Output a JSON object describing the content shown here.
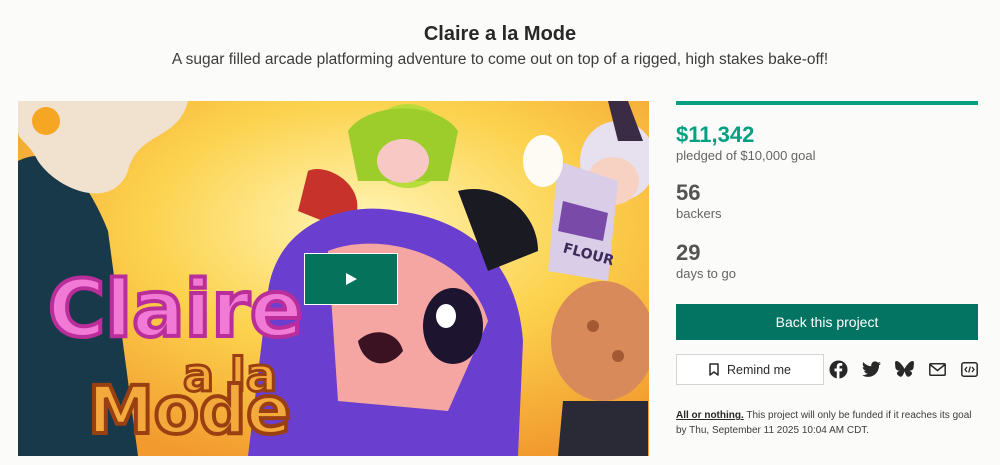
{
  "project": {
    "title": "Claire a la Mode",
    "subtitle": "A sugar filled arcade platforming adventure to come out on top of a rigged, high stakes bake-off!"
  },
  "media": {
    "logo_line1": "Claire",
    "logo_line2": "a la",
    "logo_line3": "Mode",
    "box_label": "FLOUR",
    "play_icon": "play-icon"
  },
  "funding": {
    "pledged": "$11,342",
    "pledged_label": "pledged of $10,000 goal",
    "progress_fraction": 1.0,
    "accent_color": "#05a081"
  },
  "backers": {
    "count": "56",
    "label": "backers"
  },
  "days": {
    "count": "29",
    "label": "days to go"
  },
  "actions": {
    "back_label": "Back this project",
    "back_color": "#037362",
    "remind_label": "Remind me",
    "remind_icon": "bookmark-icon",
    "share_icons": [
      "facebook-icon",
      "twitter-icon",
      "bluesky-icon",
      "email-icon",
      "embed-icon"
    ]
  },
  "notice": {
    "link_text": "All or nothing.",
    "text": " This project will only be funded if it reaches its goal by Thu, September 11 2025 10:04 AM CDT."
  }
}
